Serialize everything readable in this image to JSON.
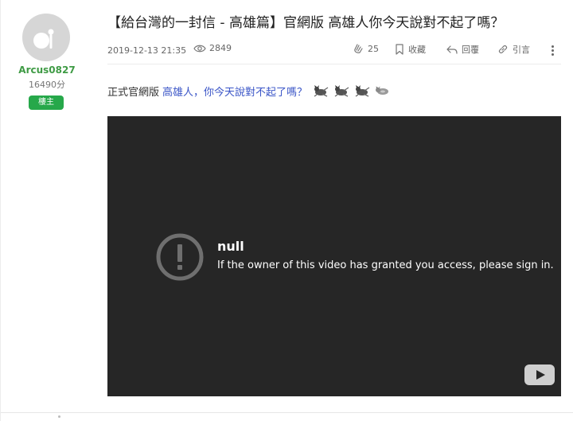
{
  "author": {
    "name": "Arcus0827",
    "points": "16490分",
    "badge": "樓主",
    "avatar_icon": "default-avatar-icon"
  },
  "post": {
    "title": "【給台灣的一封信 - 高雄篇】官網版 高雄人你今天說對不起了嗎？",
    "date": "2019-12-13 21:35",
    "views": "2849",
    "actions": {
      "like_count": "25",
      "favorite_label": "收藏",
      "reply_label": "回覆",
      "quote_label": "引言"
    },
    "body_prefix": "正式官網版",
    "body_link": "高雄人，你今天說對不起了嗎？",
    "emote_icons": [
      "dancing-cat-icon",
      "dancing-cat-icon",
      "dancing-cat-icon",
      "lying-cat-icon"
    ]
  },
  "video": {
    "error_title": "null",
    "error_message": "If the owner of this video has granted you access, please sign in.",
    "player_logo": "youtube-play-icon"
  },
  "colors": {
    "author_green": "#3f9b45",
    "badge_green": "#26a84a",
    "link_blue": "#3a55c7",
    "video_bg": "#262626"
  }
}
